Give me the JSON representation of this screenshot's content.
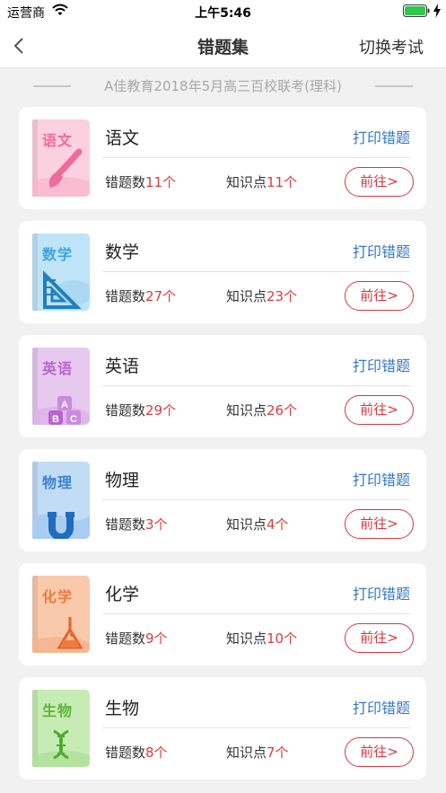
{
  "status_bar": {
    "carrier": "运营商",
    "time": "上午5:46",
    "icons": [
      "wifi-icon",
      "battery-icon",
      "charging-bolt-icon"
    ]
  },
  "nav": {
    "back_icon": "chevron-left-icon",
    "title": "错题集",
    "switch_label": "切换考试"
  },
  "exam_name": "A佳教育2018年5月高三百校联考(理科)",
  "labels": {
    "wrong_count": "错题数",
    "knowledge_count": "知识点",
    "print": "打印错题",
    "go": "前往>"
  },
  "subjects": [
    {
      "name": "语文",
      "cover_title": "语文",
      "wrong": "11个",
      "points": "11个",
      "cover_bg": "#fbd0df",
      "cover_fg": "#f06a9a",
      "icon": "paintbrush-icon"
    },
    {
      "name": "数学",
      "cover_title": "数学",
      "wrong": "27个",
      "points": "23个",
      "cover_bg": "#bfe3f7",
      "cover_fg": "#3ba6e0",
      "icon": "triangle-ruler-icon"
    },
    {
      "name": "英语",
      "cover_title": "英语",
      "wrong": "29个",
      "points": "26个",
      "cover_bg": "#e7c9ef",
      "cover_fg": "#b864cf",
      "icon": "abc-blocks-icon"
    },
    {
      "name": "物理",
      "cover_title": "物理",
      "wrong": "3个",
      "points": "4个",
      "cover_bg": "#c2dcf5",
      "cover_fg": "#3b82d0",
      "icon": "magnet-icon"
    },
    {
      "name": "化学",
      "cover_title": "化学",
      "wrong": "9个",
      "points": "10个",
      "cover_bg": "#f9c9ab",
      "cover_fg": "#ee7a3e",
      "icon": "flask-icon"
    },
    {
      "name": "生物",
      "cover_title": "生物",
      "wrong": "8个",
      "points": "7个",
      "cover_bg": "#c6ecb4",
      "cover_fg": "#5cb63a",
      "icon": "dna-icon"
    }
  ]
}
